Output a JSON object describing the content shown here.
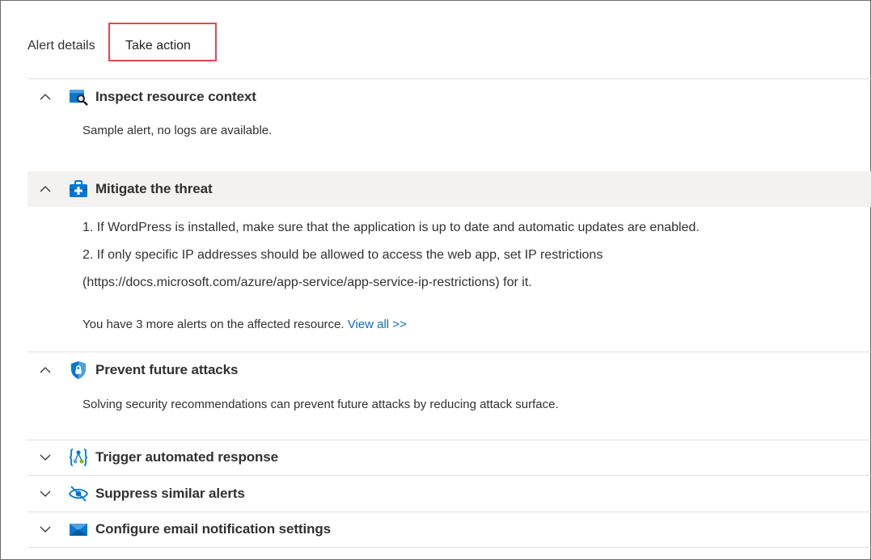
{
  "tabs": {
    "alert_details": "Alert details",
    "take_action": "Take action"
  },
  "sections": {
    "inspect": {
      "title": "Inspect resource context",
      "body": "Sample alert, no logs are available."
    },
    "mitigate": {
      "title": "Mitigate the threat",
      "step1": "1. If WordPress is installed, make sure that the application is up to date and automatic updates are enabled.",
      "step2": "2. If only specific IP addresses should be allowed to access the web app, set IP restrictions",
      "step2_link": "(https://docs.microsoft.com/azure/app-service/app-service-ip-restrictions) for it.",
      "more_alerts": "You have 3 more alerts on the affected resource.",
      "view_all": "View all >>"
    },
    "prevent": {
      "title": "Prevent future attacks",
      "body": "Solving security recommendations can prevent future attacks by reducing attack surface."
    },
    "trigger": {
      "title": "Trigger automated response"
    },
    "suppress": {
      "title": "Suppress similar alerts"
    },
    "email": {
      "title": "Configure email notification settings"
    }
  },
  "icons": {
    "expanded": "chevron-up-icon",
    "collapsed": "chevron-down-icon",
    "inspect": "resource-inspect-icon",
    "mitigate": "toolbox-icon",
    "prevent": "shield-lock-icon",
    "trigger": "logic-app-icon",
    "suppress": "eye-hidden-icon",
    "email": "email-icon"
  },
  "colors": {
    "highlight_border": "#e4474b",
    "link": "#0f6cbd",
    "azure_blue": "#0078d4"
  }
}
